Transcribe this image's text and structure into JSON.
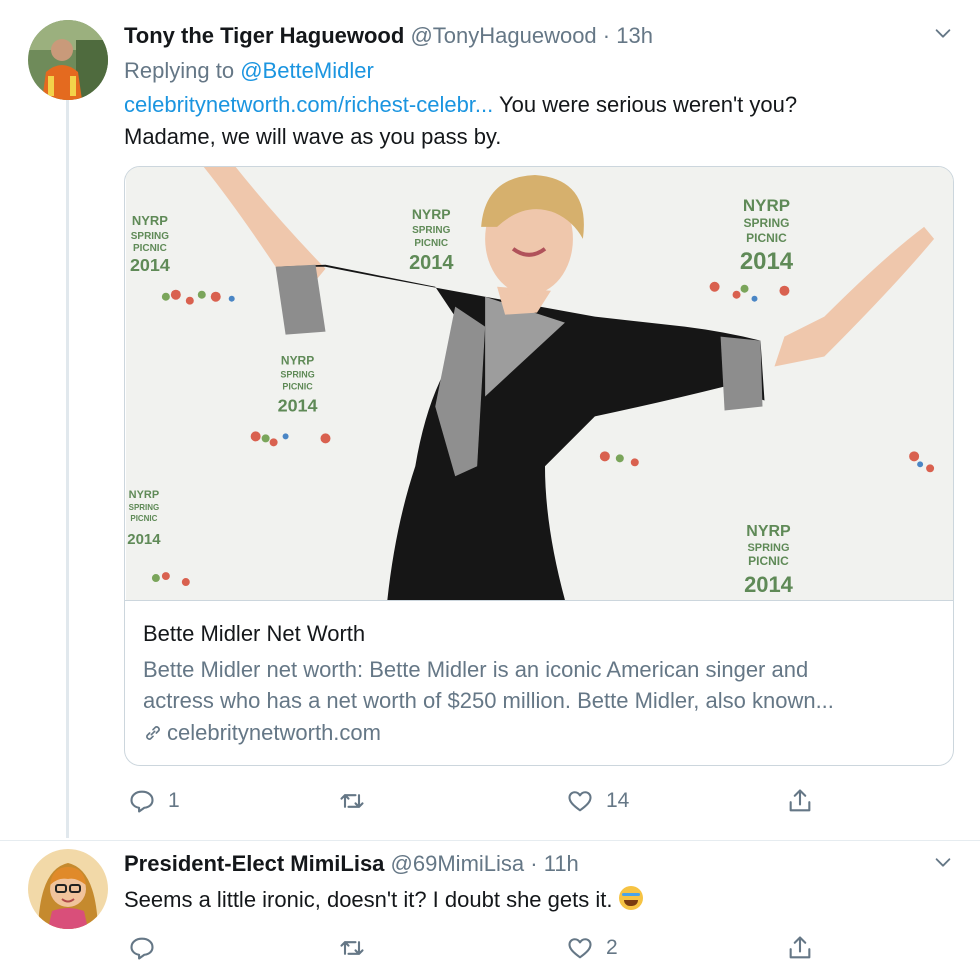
{
  "tweets": [
    {
      "name": "Tony the Tiger Haguewood",
      "handle": "@TonyHaguewood",
      "separator": "·",
      "time": "13h",
      "reply_prefix": "Replying to",
      "reply_to": "@BetteMidler",
      "link_text": "celebritynetworth.com/richest-celebr...",
      "text_line1": " You were serious weren't you?",
      "text_line2": "Madame, we will wave as you pass by.",
      "card": {
        "image_signs": [
          "NYRP",
          "SPRING",
          "PICNIC",
          "2014"
        ],
        "title": "Bette Midler Net Worth",
        "desc_line1": "Bette Midler net worth: Bette Midler is an iconic American singer and",
        "desc_line2": "actress who has a net worth of $250 million. Bette Midler, also known...",
        "domain": "celebritynetworth.com"
      },
      "counts": {
        "replies": "1",
        "retweets": "",
        "likes": "14"
      }
    },
    {
      "name": "President-Elect MimiLisa",
      "handle": "@69MimiLisa",
      "separator": "·",
      "time": "11h",
      "text": "Seems a little ironic, doesn't it? I doubt she gets it. ",
      "emoji": "face-with-tears-of-joy-emoji",
      "counts": {
        "replies": "",
        "retweets": "",
        "likes": "2"
      }
    }
  ],
  "icons": [
    "chevron-down-icon",
    "reply-icon",
    "retweet-icon",
    "like-icon",
    "share-icon",
    "link-icon"
  ],
  "colors": {
    "link": "#1b95e0",
    "secondary_text": "#657786",
    "primary_text": "#14171a",
    "border": "#ccd6dd"
  }
}
